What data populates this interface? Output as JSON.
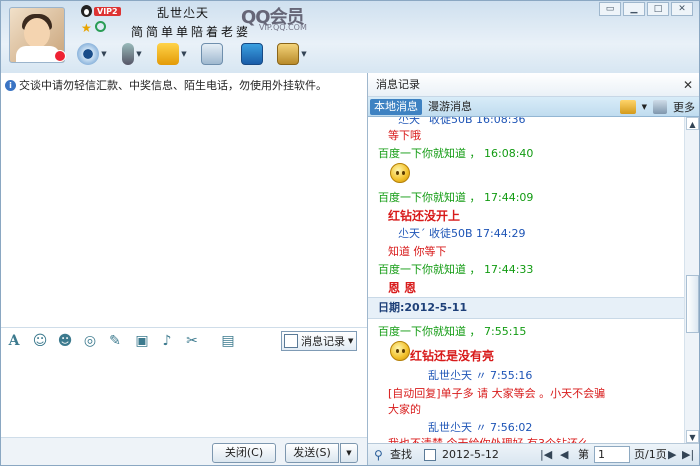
{
  "header": {
    "vip_badge": "VIP2",
    "nickname": "乱世尐天",
    "signature": "简简单单陪着老婆",
    "qq_logo": "QQ会员",
    "qq_logo_url": "VIP.QQ.COM",
    "window_buttons": [
      "▭",
      "▁",
      "□",
      "✕"
    ],
    "toolbar_icons": [
      "webcam-icon",
      "microphone-icon",
      "file-transfer-icon",
      "sms-icon",
      "remote-desktop-icon",
      "apps-icon"
    ]
  },
  "notice": {
    "text": "交谈中请勿轻信汇款、中奖信息、陌生电话，勿使用外挂软件。"
  },
  "input_toolbar": {
    "items": [
      "font-icon",
      "emoticon-icon",
      "wink-icon",
      "shake-icon",
      "note-icon",
      "image-icon",
      "music-icon",
      "screenshot-icon",
      "more-icon"
    ],
    "history_label": "消息记录"
  },
  "buttons": {
    "close": "关闭(C)",
    "send": "发送(S)"
  },
  "history": {
    "title": "消息记录",
    "tab_local": "本地消息",
    "tab_roam": "漫游消息",
    "more": "更多",
    "messages": [
      {
        "text": "尐天´ 收徒50B 16:08:36",
        "cls": "blue"
      },
      {
        "text": "等下哦",
        "cls": "red"
      },
      {
        "text": "百度一下你就知道 ， 16:08:40",
        "cls": "green"
      },
      {
        "text": "百度一下你就知道 ， 17:44:09",
        "cls": "green"
      },
      {
        "text": "红钻还没开上",
        "cls": "redb"
      },
      {
        "text": "尐天´ 收徒50B 17:44:29",
        "cls": "blue"
      },
      {
        "text": "知道  你等下",
        "cls": "red"
      },
      {
        "text": "百度一下你就知道 ， 17:44:33",
        "cls": "green"
      },
      {
        "text": "恩  恩",
        "cls": "redb"
      },
      {
        "text": "百度一下你就知道 ， 7:55:15",
        "cls": "green"
      },
      {
        "text": "红钻还是没有亮",
        "cls": "redb"
      },
      {
        "text": "乱世尐天    〃    7:55:16",
        "cls": "blue"
      },
      {
        "text": "[自动回复]单子多  请  大家等会  。小天不会骗",
        "cls": "red"
      },
      {
        "text": "大家的",
        "cls": "red"
      },
      {
        "text": "乱世尐天    〃    7:56:02",
        "cls": "blue"
      },
      {
        "text": "我也不清楚  今天给你处理好   有3个钻还么",
        "cls": "red"
      }
    ],
    "date": "日期:2012-5-11",
    "search": "查找",
    "current_date": "2012-5-12",
    "page_prefix": "第",
    "page_value": "1",
    "page_suffix": "页/1页"
  }
}
